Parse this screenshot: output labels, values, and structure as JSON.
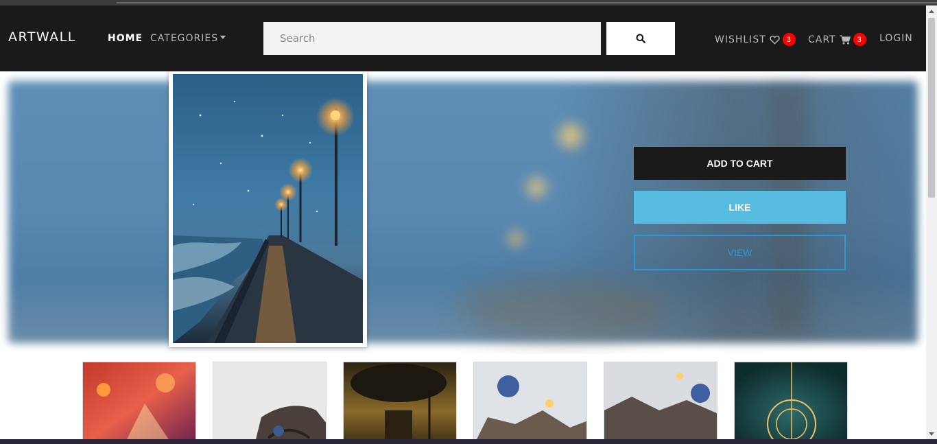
{
  "nav": {
    "brand": "ARTWALL",
    "home": "HOME",
    "categories": "CATEGORIES",
    "search_placeholder": "Search",
    "search_icon": "search-icon",
    "wishlist": "WISHLIST",
    "wishlist_count": "3",
    "cart": "CART",
    "cart_count": "3",
    "login": "LOGIN"
  },
  "actions": {
    "add_to_cart": "ADD TO CART",
    "like": "LIKE",
    "view": "VIEW"
  },
  "colors": {
    "navbar_bg": "#1b1a1a",
    "badge": "#ff0000",
    "like_button": "#58bce0",
    "view_border": "#2a9ad2"
  },
  "thumbnails": [
    "painting-thumbnail",
    "painting-thumbnail",
    "painting-thumbnail",
    "painting-thumbnail",
    "painting-thumbnail",
    "painting-thumbnail"
  ]
}
